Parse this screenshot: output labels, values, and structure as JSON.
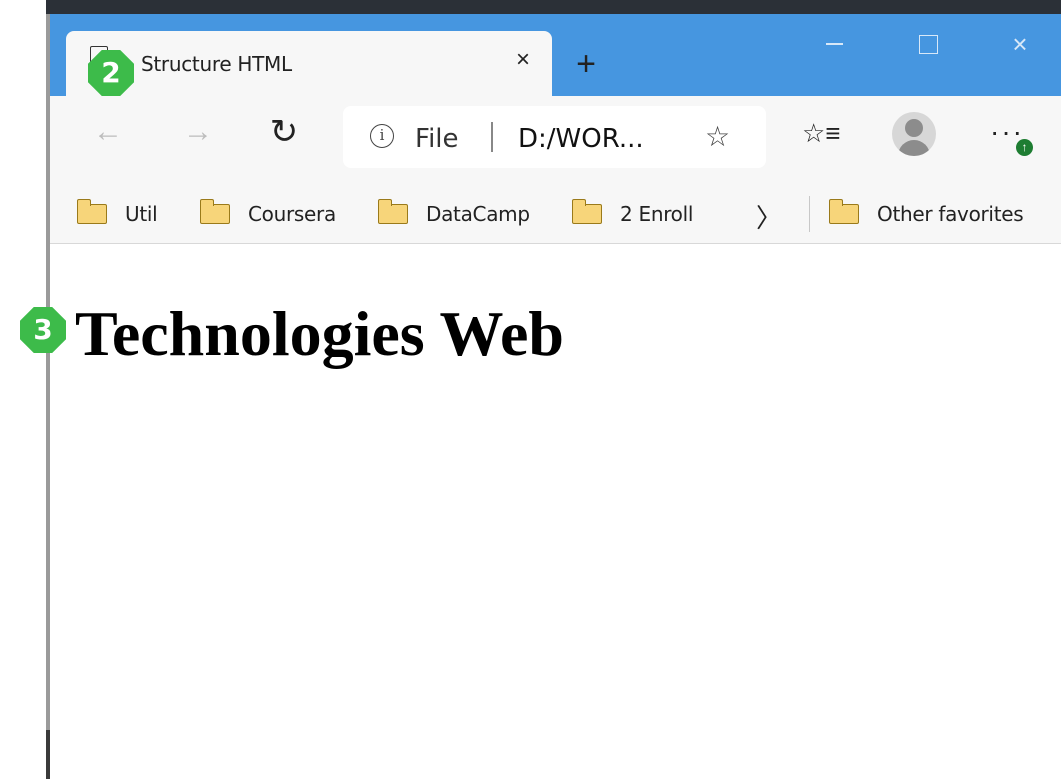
{
  "tab": {
    "title": "Structure HTML",
    "close": "×"
  },
  "new_tab": "+",
  "window_controls": {
    "close": "×"
  },
  "toolbar": {
    "back": "←",
    "forward": "→",
    "reload": "↻",
    "info": "i",
    "scheme": "File",
    "url": "D:/WOR...",
    "star": "☆",
    "favorites": "☆≡",
    "more": "···",
    "update": "↑"
  },
  "bookmarks": {
    "items": [
      {
        "label": "Util"
      },
      {
        "label": "Coursera"
      },
      {
        "label": "DataCamp"
      },
      {
        "label": "2 Enroll"
      }
    ],
    "more": "〉",
    "other": "Other favorites"
  },
  "content": {
    "heading": "Technologies Web"
  },
  "annotations": {
    "badge_tab": "2",
    "badge_heading": "3"
  },
  "colors": {
    "titlebar": "#4696e0",
    "toolbar": "#f7f7f7",
    "badge": "#3dbb4a",
    "folder": "#f7d57a"
  }
}
